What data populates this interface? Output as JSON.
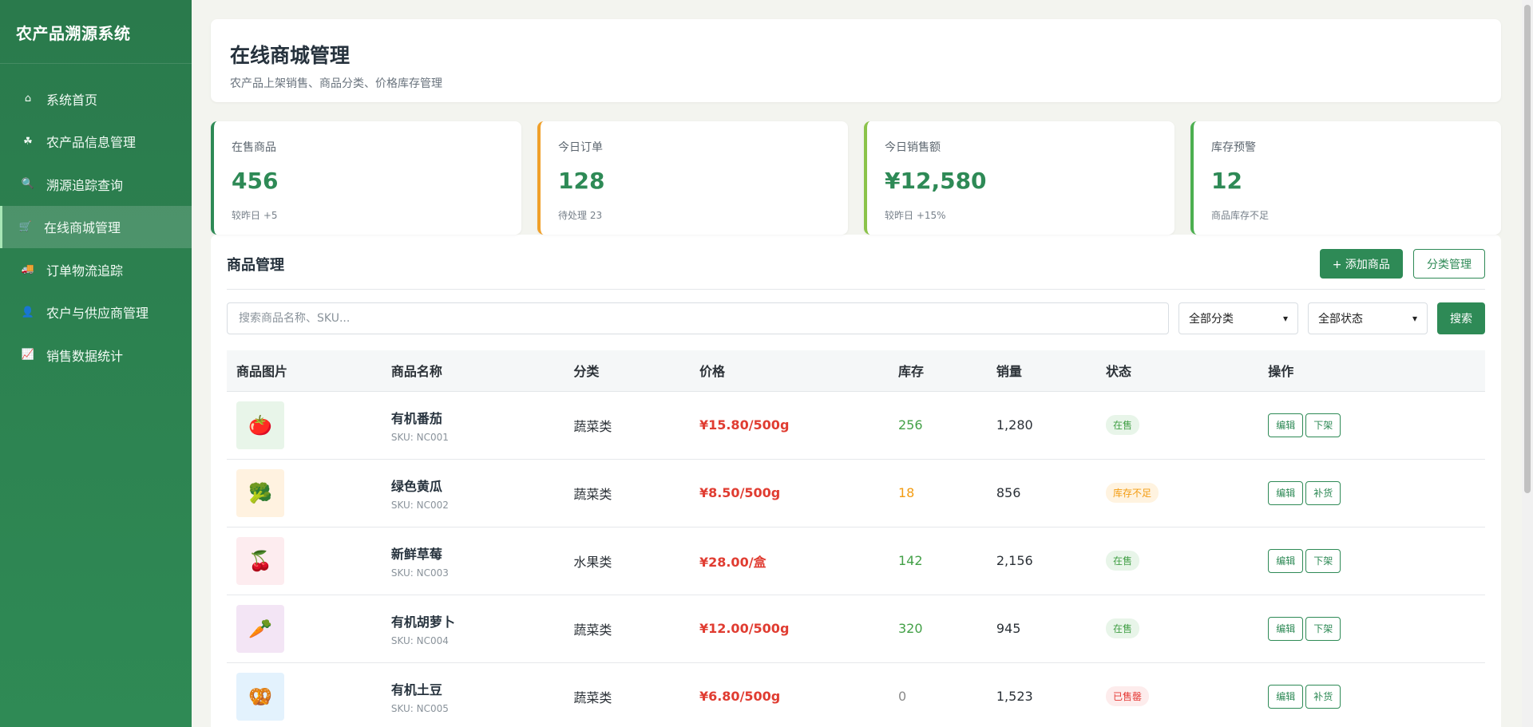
{
  "sidebar": {
    "brand": "农产品溯源系统",
    "items": [
      {
        "label": "系统首页",
        "icon": "⌂",
        "active": false
      },
      {
        "label": "农产品信息管理",
        "icon": "☘",
        "active": false
      },
      {
        "label": "溯源追踪查询",
        "icon": "🔍",
        "active": false
      },
      {
        "label": "在线商城管理",
        "icon": "🛒",
        "active": true
      },
      {
        "label": "订单物流追踪",
        "icon": "🚚",
        "active": false
      },
      {
        "label": "农户与供应商管理",
        "icon": "👤",
        "active": false
      },
      {
        "label": "销售数据统计",
        "icon": "📈",
        "active": false
      }
    ]
  },
  "header": {
    "title": "在线商城管理",
    "subtitle": "农产品上架销售、商品分类、价格库存管理"
  },
  "stats": [
    {
      "label": "在售商品",
      "value": "456",
      "note": "较昨日 +5",
      "accent": "#2e8a56"
    },
    {
      "label": "今日订单",
      "value": "128",
      "note": "待处理 23",
      "accent": "#f0a02a"
    },
    {
      "label": "今日销售额",
      "value": "¥12,580",
      "note": "较昨日 +15%",
      "accent": "#8bc34a"
    },
    {
      "label": "库存预警",
      "value": "12",
      "note": "商品库存不足",
      "accent": "#4caf50"
    }
  ],
  "panel": {
    "title": "商品管理",
    "add_button": "+ 添加商品",
    "category_button": "分类管理",
    "search_placeholder": "搜索商品名称、SKU...",
    "category_select": "全部分类",
    "status_select": "全部状态",
    "search_button": "搜索"
  },
  "table": {
    "headers": [
      "商品图片",
      "商品名称",
      "分类",
      "价格",
      "库存",
      "销量",
      "状态",
      "操作"
    ],
    "rows": [
      {
        "icon": "🍅",
        "icon_bg": "#e8f5e9",
        "name": "有机番茄",
        "sku": "SKU: NC001",
        "category": "蔬菜类",
        "price": "¥15.80/500g",
        "stock": "256",
        "stock_color": "#43a047",
        "sales": "1,280",
        "status": "在售",
        "status_bg": "#e8f5e9",
        "status_fg": "#43a047",
        "action1": "编辑",
        "action2": "下架"
      },
      {
        "icon": "🥦",
        "icon_bg": "#fff2e0",
        "name": "绿色黄瓜",
        "sku": "SKU: NC002",
        "category": "蔬菜类",
        "price": "¥8.50/500g",
        "stock": "18",
        "stock_color": "#f39c12",
        "sales": "856",
        "status": "库存不足",
        "status_bg": "#fff3e0",
        "status_fg": "#f39c12",
        "action1": "编辑",
        "action2": "补货"
      },
      {
        "icon": "🍒",
        "icon_bg": "#fdecef",
        "name": "新鲜草莓",
        "sku": "SKU: NC003",
        "category": "水果类",
        "price": "¥28.00/盒",
        "stock": "142",
        "stock_color": "#43a047",
        "sales": "2,156",
        "status": "在售",
        "status_bg": "#e8f5e9",
        "status_fg": "#43a047",
        "action1": "编辑",
        "action2": "下架"
      },
      {
        "icon": "🥕",
        "icon_bg": "#f3e5f5",
        "name": "有机胡萝卜",
        "sku": "SKU: NC004",
        "category": "蔬菜类",
        "price": "¥12.00/500g",
        "stock": "320",
        "stock_color": "#43a047",
        "sales": "945",
        "status": "在售",
        "status_bg": "#e8f5e9",
        "status_fg": "#43a047",
        "action1": "编辑",
        "action2": "下架"
      },
      {
        "icon": "🥨",
        "icon_bg": "#e3f2fd",
        "name": "有机土豆",
        "sku": "SKU: NC005",
        "category": "蔬菜类",
        "price": "¥6.80/500g",
        "stock": "0",
        "stock_color": "#8a8a8a",
        "sales": "1,523",
        "status": "已售罄",
        "status_bg": "#fdecec",
        "status_fg": "#e53935",
        "action1": "编辑",
        "action2": "补货"
      }
    ]
  }
}
